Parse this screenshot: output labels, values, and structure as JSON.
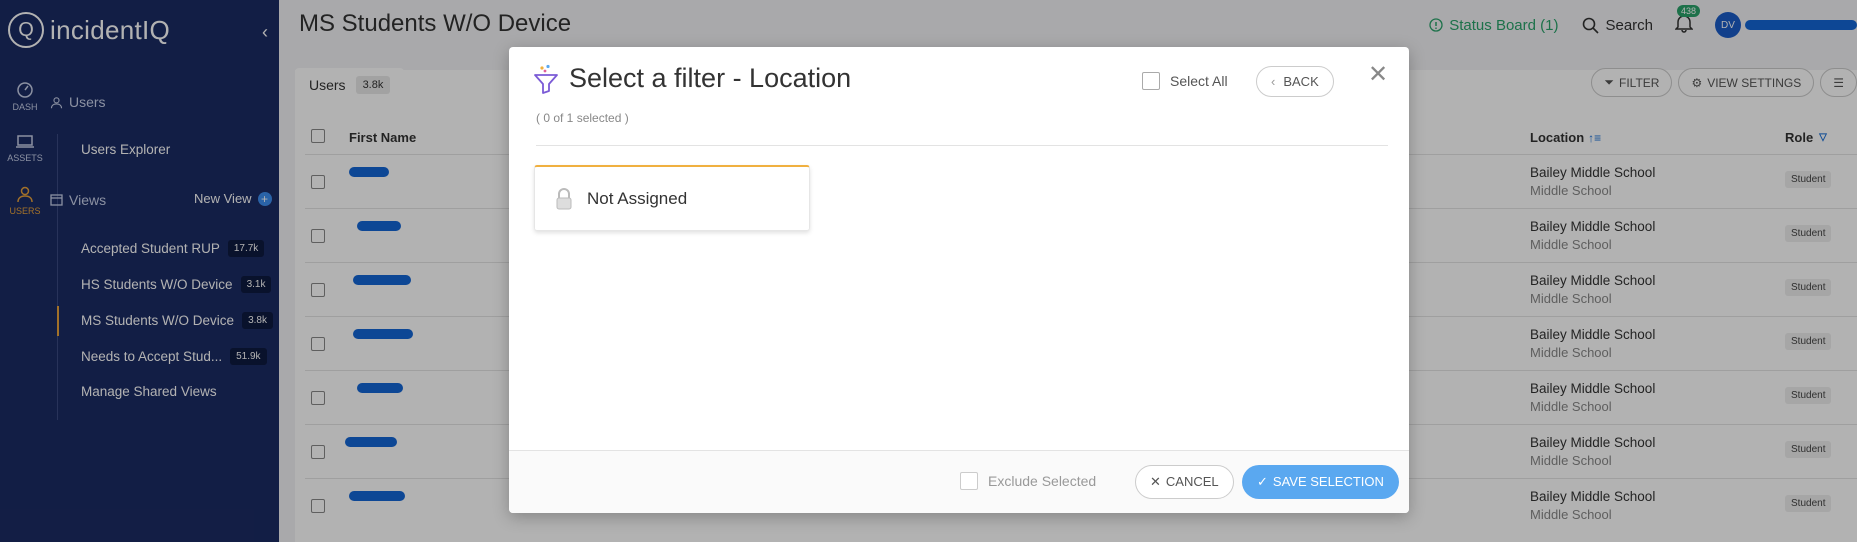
{
  "app": {
    "name": "incidentIQ",
    "logo_mark": "Q"
  },
  "rail": [
    {
      "label": "DASH",
      "icon": "dashboard-icon"
    },
    {
      "label": "ASSETS",
      "icon": "laptop-icon"
    },
    {
      "label": "USERS",
      "icon": "user-icon"
    }
  ],
  "sidebar": {
    "users_label": "Users",
    "users_explorer": "Users Explorer",
    "views_label": "Views",
    "new_view": "New View",
    "views": [
      {
        "label": "Accepted Student RUP",
        "count": "17.7k"
      },
      {
        "label": "HS Students W/O Device",
        "count": "3.1k"
      },
      {
        "label": "MS Students W/O Device",
        "count": "3.8k"
      },
      {
        "label": "Needs to Accept Stud...",
        "count": "51.9k"
      }
    ],
    "manage": "Manage Shared Views"
  },
  "header": {
    "title": "MS Students W/O Device",
    "status_board": "Status Board (1)",
    "search": "Search",
    "notifications": "438",
    "avatar": "DV"
  },
  "table": {
    "tab_label": "Users",
    "tab_count": "3.8k",
    "filter": "FILTER",
    "view_settings": "VIEW SETTINGS",
    "columns": {
      "first_name": "First Name",
      "location": "Location",
      "role": "Role"
    },
    "rows": [
      {
        "location": "Bailey Middle School",
        "location_type": "Middle School",
        "role": "Student"
      },
      {
        "location": "Bailey Middle School",
        "location_type": "Middle School",
        "role": "Student"
      },
      {
        "location": "Bailey Middle School",
        "location_type": "Middle School",
        "role": "Student"
      },
      {
        "location": "Bailey Middle School",
        "location_type": "Middle School",
        "role": "Student"
      },
      {
        "location": "Bailey Middle School",
        "location_type": "Middle School",
        "role": "Student"
      },
      {
        "location": "Bailey Middle School",
        "location_type": "Middle School",
        "role": "Student"
      },
      {
        "location": "Bailey Middle School",
        "location_type": "Middle School",
        "role": "Student"
      }
    ]
  },
  "modal": {
    "title": "Select a filter - Location",
    "subtitle": "( 0 of 1 selected )",
    "select_all": "Select All",
    "back": "BACK",
    "option": "Not Assigned",
    "exclude": "Exclude Selected",
    "cancel": "CANCEL",
    "save": "SAVE SELECTION"
  },
  "colors": {
    "sidebar": "#1b2b63",
    "accent": "#e9a23b",
    "status_green": "#2aa36b",
    "primary_blue": "#5aa8f0"
  }
}
